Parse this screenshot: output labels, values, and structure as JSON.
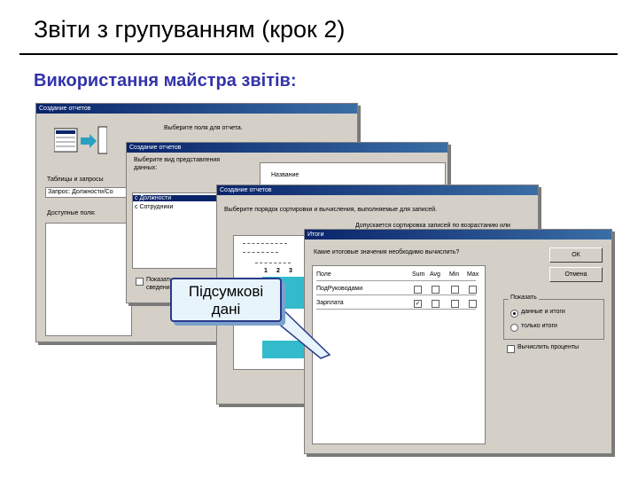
{
  "slide": {
    "title": "Звіти з групуванням (крок 2)",
    "subtitle": "Використання майстра звітів:"
  },
  "win1": {
    "title": "Создание отчетов",
    "prompt": "Выберите поля для отчета.",
    "tables_label": "Таблицы и запросы",
    "tables_value": "Запрос: Должности/Со",
    "available_label": "Доступные поля:"
  },
  "win2": {
    "title": "Создание отчетов",
    "prompt_line1": "Выберите вид представления",
    "prompt_line2": "данных:",
    "list_items": [
      "с Должности",
      "с Сотрудники"
    ],
    "preview_field": "Название",
    "checkbox_line1": "Показать",
    "checkbox_line2": "сведения"
  },
  "win3": {
    "title": "Создание отчетов",
    "prompt": "Выберите порядок сортировки и вычисления, выполняемые для записей.",
    "hint": "Допускается сортировка записей по возрастанию или",
    "numbers": [
      "1",
      "2",
      "3"
    ]
  },
  "win4": {
    "title": "Итоги",
    "question": "Какие итоговые значения необходимо вычислить?",
    "columns": [
      "Поле",
      "Sum",
      "Avg",
      "Min",
      "Max"
    ],
    "rows": [
      {
        "field": "ПодРуководами",
        "checks": [
          "",
          "",
          "",
          ""
        ]
      },
      {
        "field": "Зарплата",
        "checks": [
          "✓",
          "",
          "",
          ""
        ]
      }
    ],
    "ok_label": "ОК",
    "cancel_label": "Отмена",
    "show_group": "Показать",
    "radio_1": "данные и итоги",
    "radio_2": "только итоги",
    "percent_label": "Вычислить проценты"
  },
  "callout": {
    "line1": "Підсумкові",
    "line2": "дані"
  },
  "colors": {
    "subtitle": "#3333aa",
    "titlebar": "#0a246a",
    "dialog": "#d4d0c8",
    "callout_border": "#2a3a8a"
  }
}
